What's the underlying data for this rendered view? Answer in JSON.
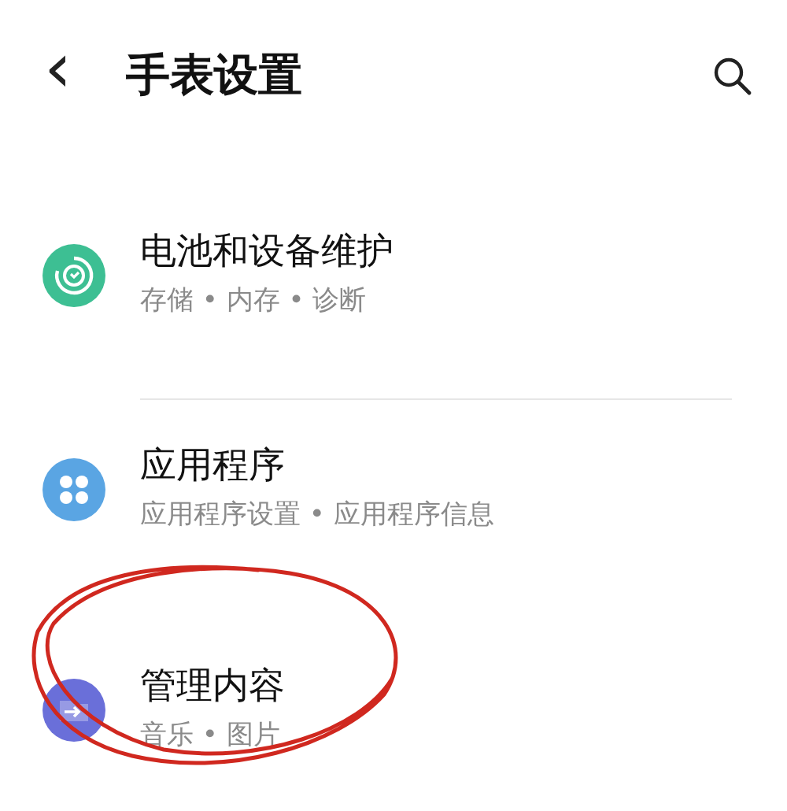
{
  "header": {
    "back": "‹",
    "title": "手表设置"
  },
  "items": [
    {
      "kind": "maintenance",
      "color": "#3dbf93",
      "title": "电池和设备维护",
      "subtitle": "存储 • 内存 • 诊断",
      "divider": true
    },
    {
      "kind": "apps",
      "color": "#5aa5e3",
      "title": "应用程序",
      "subtitle": "应用程序设置 • 应用程序信息",
      "divider": false
    },
    {
      "kind": "content",
      "color": "#6a6fd9",
      "title": "管理内容",
      "subtitle": "音乐 • 图片",
      "divider": false
    }
  ]
}
